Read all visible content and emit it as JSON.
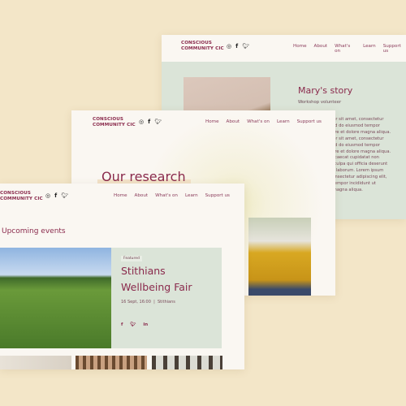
{
  "brand": {
    "logo_line1": "CONSCIOUS",
    "logo_line2": "COMMUNITY CIC"
  },
  "social_icons": [
    "instagram-icon",
    "facebook-icon",
    "twitter-icon"
  ],
  "nav": [
    "Home",
    "About",
    "What's on",
    "Learn",
    "Support us"
  ],
  "story_page": {
    "title": "Mary's story",
    "subtitle": "Workshop volunteer",
    "body": [
      "Lorem ipsum dolor sit amet, consectetur",
      "adipiscing elit, sed do eiusmod tempor",
      "incididunt ut labore et dolore magna aliqua.",
      "Lorem ipsum dolor sit amet, consectetur",
      "adipiscing elit, sed do eiusmod tempor",
      "incididunt ut labore et dolore magna aliqua.",
      "Excepteur sint occaecat cupidatat non",
      "proident, sunt in culpa qui officia deserunt",
      "mollit anim id est laborum. Lorem ipsum",
      "dolor sit amet, consectetur adipiscing elit,",
      "sed do eiusmod tempor incididunt ut",
      "labore et dolore magna aliqua."
    ]
  },
  "research_page": {
    "title": "Our research"
  },
  "events_page": {
    "title": "Upcoming events",
    "featured_badge": "Featured",
    "event_title_line1": "Stithians",
    "event_title_line2": "Wellbeing Fair",
    "event_date": "16 Sept, 16:00",
    "event_location": "Stithians",
    "share_icons": [
      "facebook-icon",
      "twitter-icon",
      "linkedin-icon"
    ]
  },
  "colors": {
    "background": "#f3e6c8",
    "card": "#faf7f2",
    "green_panel": "#dbe4d8",
    "accent": "#8a2a4c"
  }
}
